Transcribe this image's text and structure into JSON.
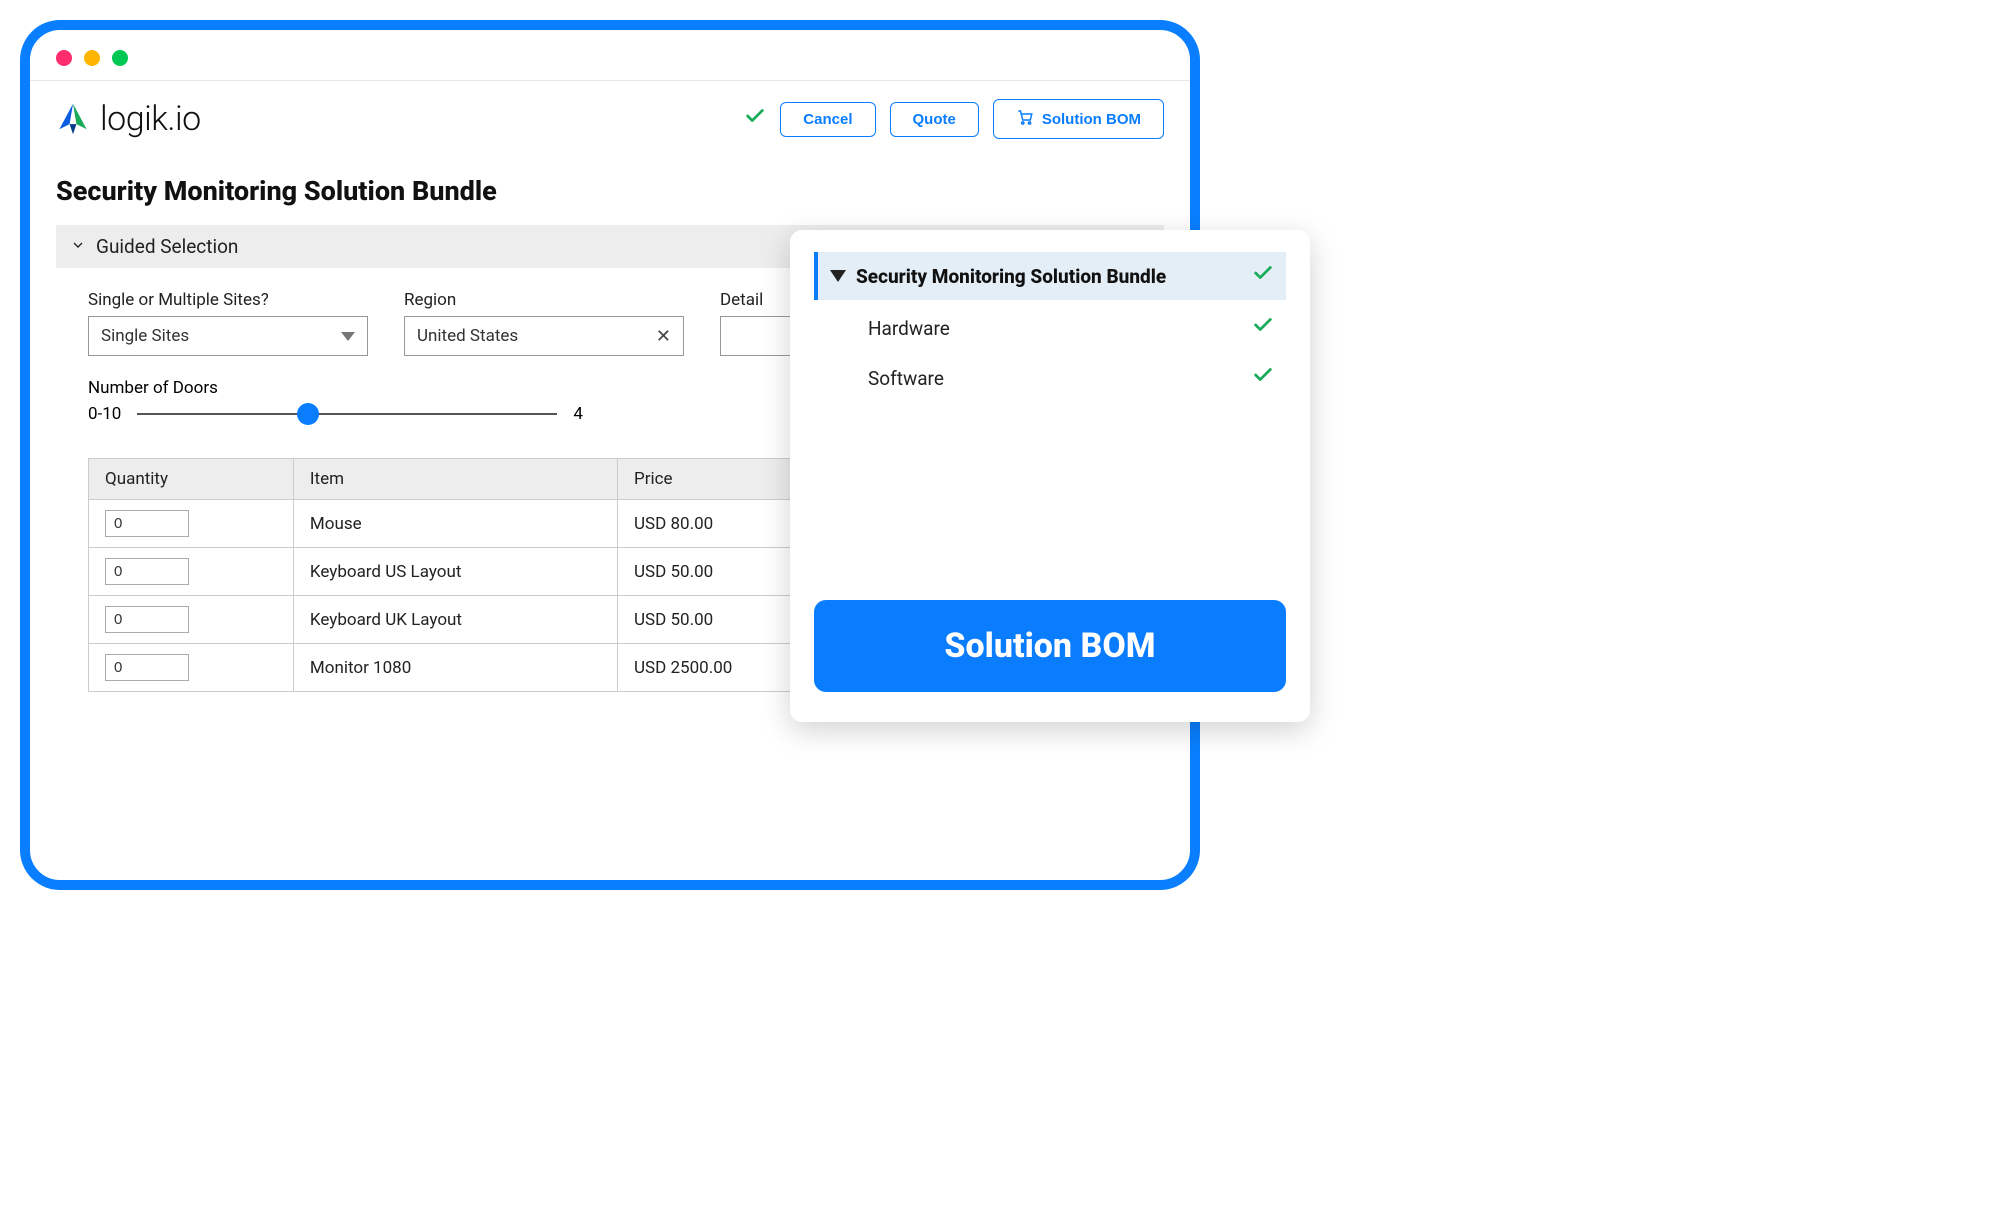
{
  "brand": {
    "name": "logik.io"
  },
  "header": {
    "cancel": "Cancel",
    "quote": "Quote",
    "solution_bom": "Solution BOM"
  },
  "page": {
    "title": "Security Monitoring Solution Bundle",
    "section": "Guided Selection"
  },
  "fields": {
    "sites_label": "Single or Multiple Sites?",
    "sites_value": "Single Sites",
    "region_label": "Region",
    "region_value": "United States",
    "detail_label": "Detail",
    "detail_value": "",
    "doors_label": "Number of Doors",
    "doors_range": "0-10",
    "doors_value": "4"
  },
  "table": {
    "headers": {
      "qty": "Quantity",
      "item": "Item",
      "price": "Price"
    },
    "rows": [
      {
        "qty": "0",
        "item": "Mouse",
        "price": "USD 80.00"
      },
      {
        "qty": "0",
        "item": "Keyboard US Layout",
        "price": "USD 50.00"
      },
      {
        "qty": "0",
        "item": "Keyboard UK Layout",
        "price": "USD 50.00"
      },
      {
        "qty": "0",
        "item": "Monitor 1080",
        "price": "USD 2500.00"
      }
    ]
  },
  "bom": {
    "title": "Security Monitoring Solution Bundle",
    "items": [
      "Hardware",
      "Software"
    ],
    "cta": "Solution BOM"
  }
}
